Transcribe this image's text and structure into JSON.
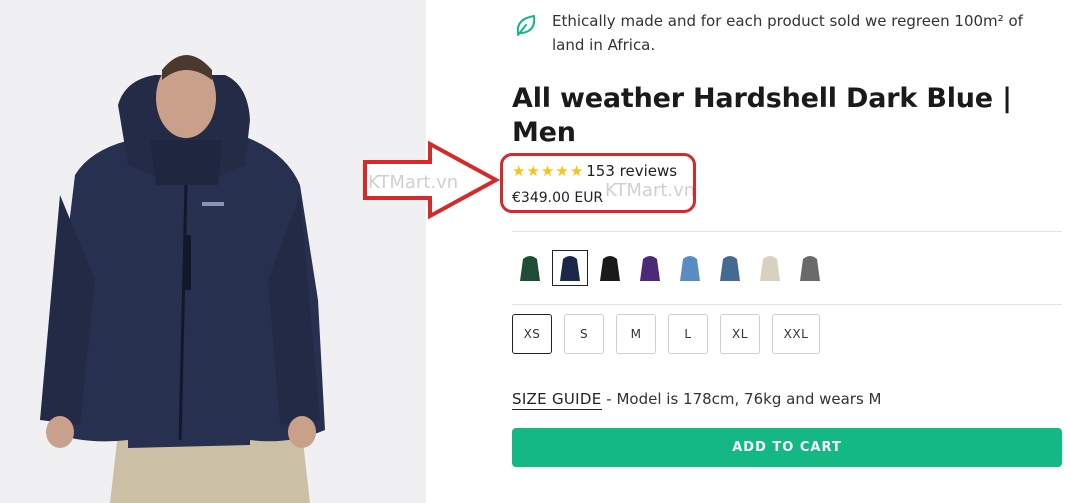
{
  "product": {
    "eco_message": "Ethically made and for each product sold we regreen 100m² of land in Africa.",
    "title": "All weather Hardshell Dark Blue | Men",
    "reviews_label": "153 reviews",
    "rating": 5,
    "price": "€349.00 EUR"
  },
  "icons": {
    "eco": "leaf-icon",
    "stars": "star-icon"
  },
  "watermarks": [
    "KTMart.vn",
    "KTMart.vn"
  ],
  "swatches": [
    {
      "color": "#1f4d38"
    },
    {
      "color": "#1c2847",
      "selected": true
    },
    {
      "color": "#1a1a1a"
    },
    {
      "color": "#4b2a7a"
    },
    {
      "color": "#5a8cc4"
    },
    {
      "color": "#456a90"
    },
    {
      "color": "#d9d1c0"
    },
    {
      "color": "#6a6a6a"
    }
  ],
  "sizes": {
    "xs": "XS",
    "s": "S",
    "m": "M",
    "l": "L",
    "xl": "XL",
    "xxl": "XXL",
    "selected": "XS"
  },
  "size_guide": {
    "link": "SIZE GUIDE",
    "note": " - Model is 178cm, 76kg and wears M"
  },
  "cta": {
    "add_to_cart": "ADD TO CART"
  },
  "colors": {
    "accent": "#14b882",
    "annotation": "#d42a2a",
    "star": "#f5c518"
  }
}
